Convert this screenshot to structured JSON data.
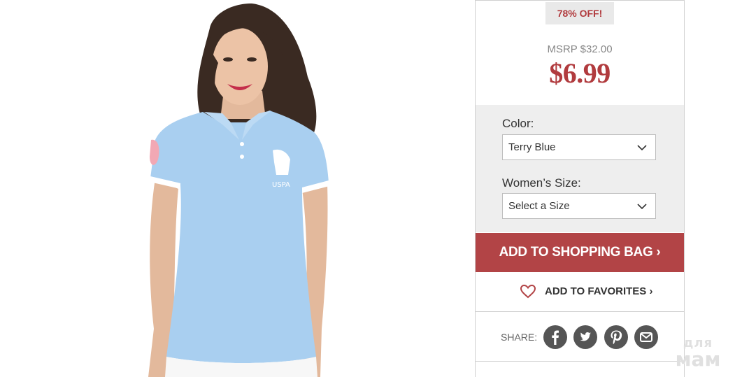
{
  "product": {
    "image_alt": "Model wearing light blue polo shirt"
  },
  "pricing": {
    "discount_badge": "78% OFF!",
    "msrp": "MSRP $32.00",
    "sale_price": "$6.99"
  },
  "options": {
    "color_label": "Color:",
    "color_selected": "Terry Blue",
    "size_label": "Women’s Size:",
    "size_selected": "Select a Size"
  },
  "actions": {
    "add_to_bag": "ADD TO SHOPPING BAG ›",
    "add_to_favorites": "ADD TO FAVORITES ›"
  },
  "share": {
    "label": "SHARE:",
    "icons": [
      "facebook-icon",
      "twitter-icon",
      "pinterest-icon",
      "email-icon"
    ]
  },
  "watermark": {
    "line1": "для",
    "line2": "мам"
  },
  "colors": {
    "accent": "#b24446",
    "price_red": "#b13b3e",
    "options_bg": "#eeeeee",
    "social_bg": "#555555",
    "shirt_blue": "#a9cff0"
  }
}
